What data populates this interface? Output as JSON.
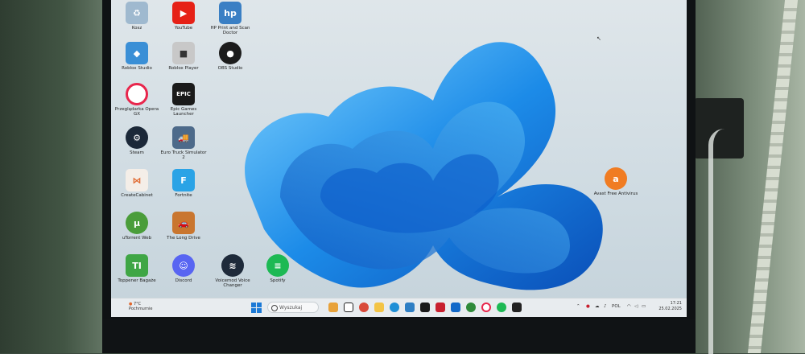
{
  "desktop": {
    "icons": [
      {
        "label": "Kosz",
        "icon": "recycle-bin-icon",
        "color": "#9fb9cf"
      },
      {
        "label": "YouTube",
        "icon": "youtube-icon",
        "color": "#e62117"
      },
      {
        "label": "HP Print and Scan Doctor",
        "icon": "hp-doctor-icon",
        "color": "#3a7fc4"
      },
      {
        "label": "Roblox Studio",
        "icon": "roblox-studio-icon",
        "color": "#3a8fd6"
      },
      {
        "label": "Roblox Player",
        "icon": "roblox-player-icon",
        "color": "#c8c8c8"
      },
      {
        "label": "OBS Studio",
        "icon": "obs-icon",
        "color": "#1c1c1c"
      },
      {
        "label": "Przeglądarka Opera GX",
        "icon": "opera-gx-icon",
        "color": "#e8264c"
      },
      {
        "label": "Epic Games Launcher",
        "icon": "epic-games-icon",
        "color": "#1a1a1a"
      },
      {
        "label": "Steam",
        "icon": "steam-icon",
        "color": "#1b2838"
      },
      {
        "label": "Euro Truck Simulator 2",
        "icon": "euro-truck-icon",
        "color": "#4d6a8a"
      },
      {
        "label": "CreateCabinet",
        "icon": "share-network-icon",
        "color": "#e0672d"
      },
      {
        "label": "Fortnite",
        "icon": "fortnite-icon",
        "color": "#2aa3e6"
      },
      {
        "label": "uTorrent Web",
        "icon": "utorrent-icon",
        "color": "#4a9d3a"
      },
      {
        "label": "The Long Drive",
        "icon": "long-drive-icon",
        "color": "#c9762f"
      },
      {
        "label": "Toppener Bagaże",
        "icon": "ti-icon",
        "color": "#3fa645"
      },
      {
        "label": "Discord",
        "icon": "discord-icon",
        "color": "#5865f2"
      },
      {
        "label": "Voicemod Voice Changer",
        "icon": "voicemod-icon",
        "color": "#1e2a3a"
      },
      {
        "label": "Spotify",
        "icon": "spotify-icon",
        "color": "#1db954"
      },
      {
        "label": "Avast Free Antivirus",
        "icon": "avast-icon",
        "color": "#f07c22"
      }
    ]
  },
  "taskbar": {
    "weather_temp": "7°C",
    "weather_desc": "Pochmurnie",
    "search_placeholder": "Wyszukaj",
    "language": "POL",
    "time": "17:21",
    "date": "25.02.2025",
    "apps": [
      {
        "icon": "widgets-icon",
        "color": "#e8a23a"
      },
      {
        "icon": "l-app-icon",
        "color": "#222222"
      },
      {
        "icon": "chrome-icon",
        "color": "#d94a3a"
      },
      {
        "icon": "file-explorer-icon",
        "color": "#f3c446"
      },
      {
        "icon": "edge-icon",
        "color": "#1f8fd6"
      },
      {
        "icon": "photos-icon",
        "color": "#2f7fc4"
      },
      {
        "icon": "l-dark-icon",
        "color": "#1a1a1a"
      },
      {
        "icon": "mcafee-icon",
        "color": "#c8202f"
      },
      {
        "icon": "outlook-icon",
        "color": "#1269c9"
      },
      {
        "icon": "xbox-icon",
        "color": "#2f8a3a"
      },
      {
        "icon": "opera-icon",
        "color": "#e8264c"
      },
      {
        "icon": "spotify-icon",
        "color": "#1db954"
      },
      {
        "icon": "epic-icon",
        "color": "#222222"
      }
    ]
  }
}
